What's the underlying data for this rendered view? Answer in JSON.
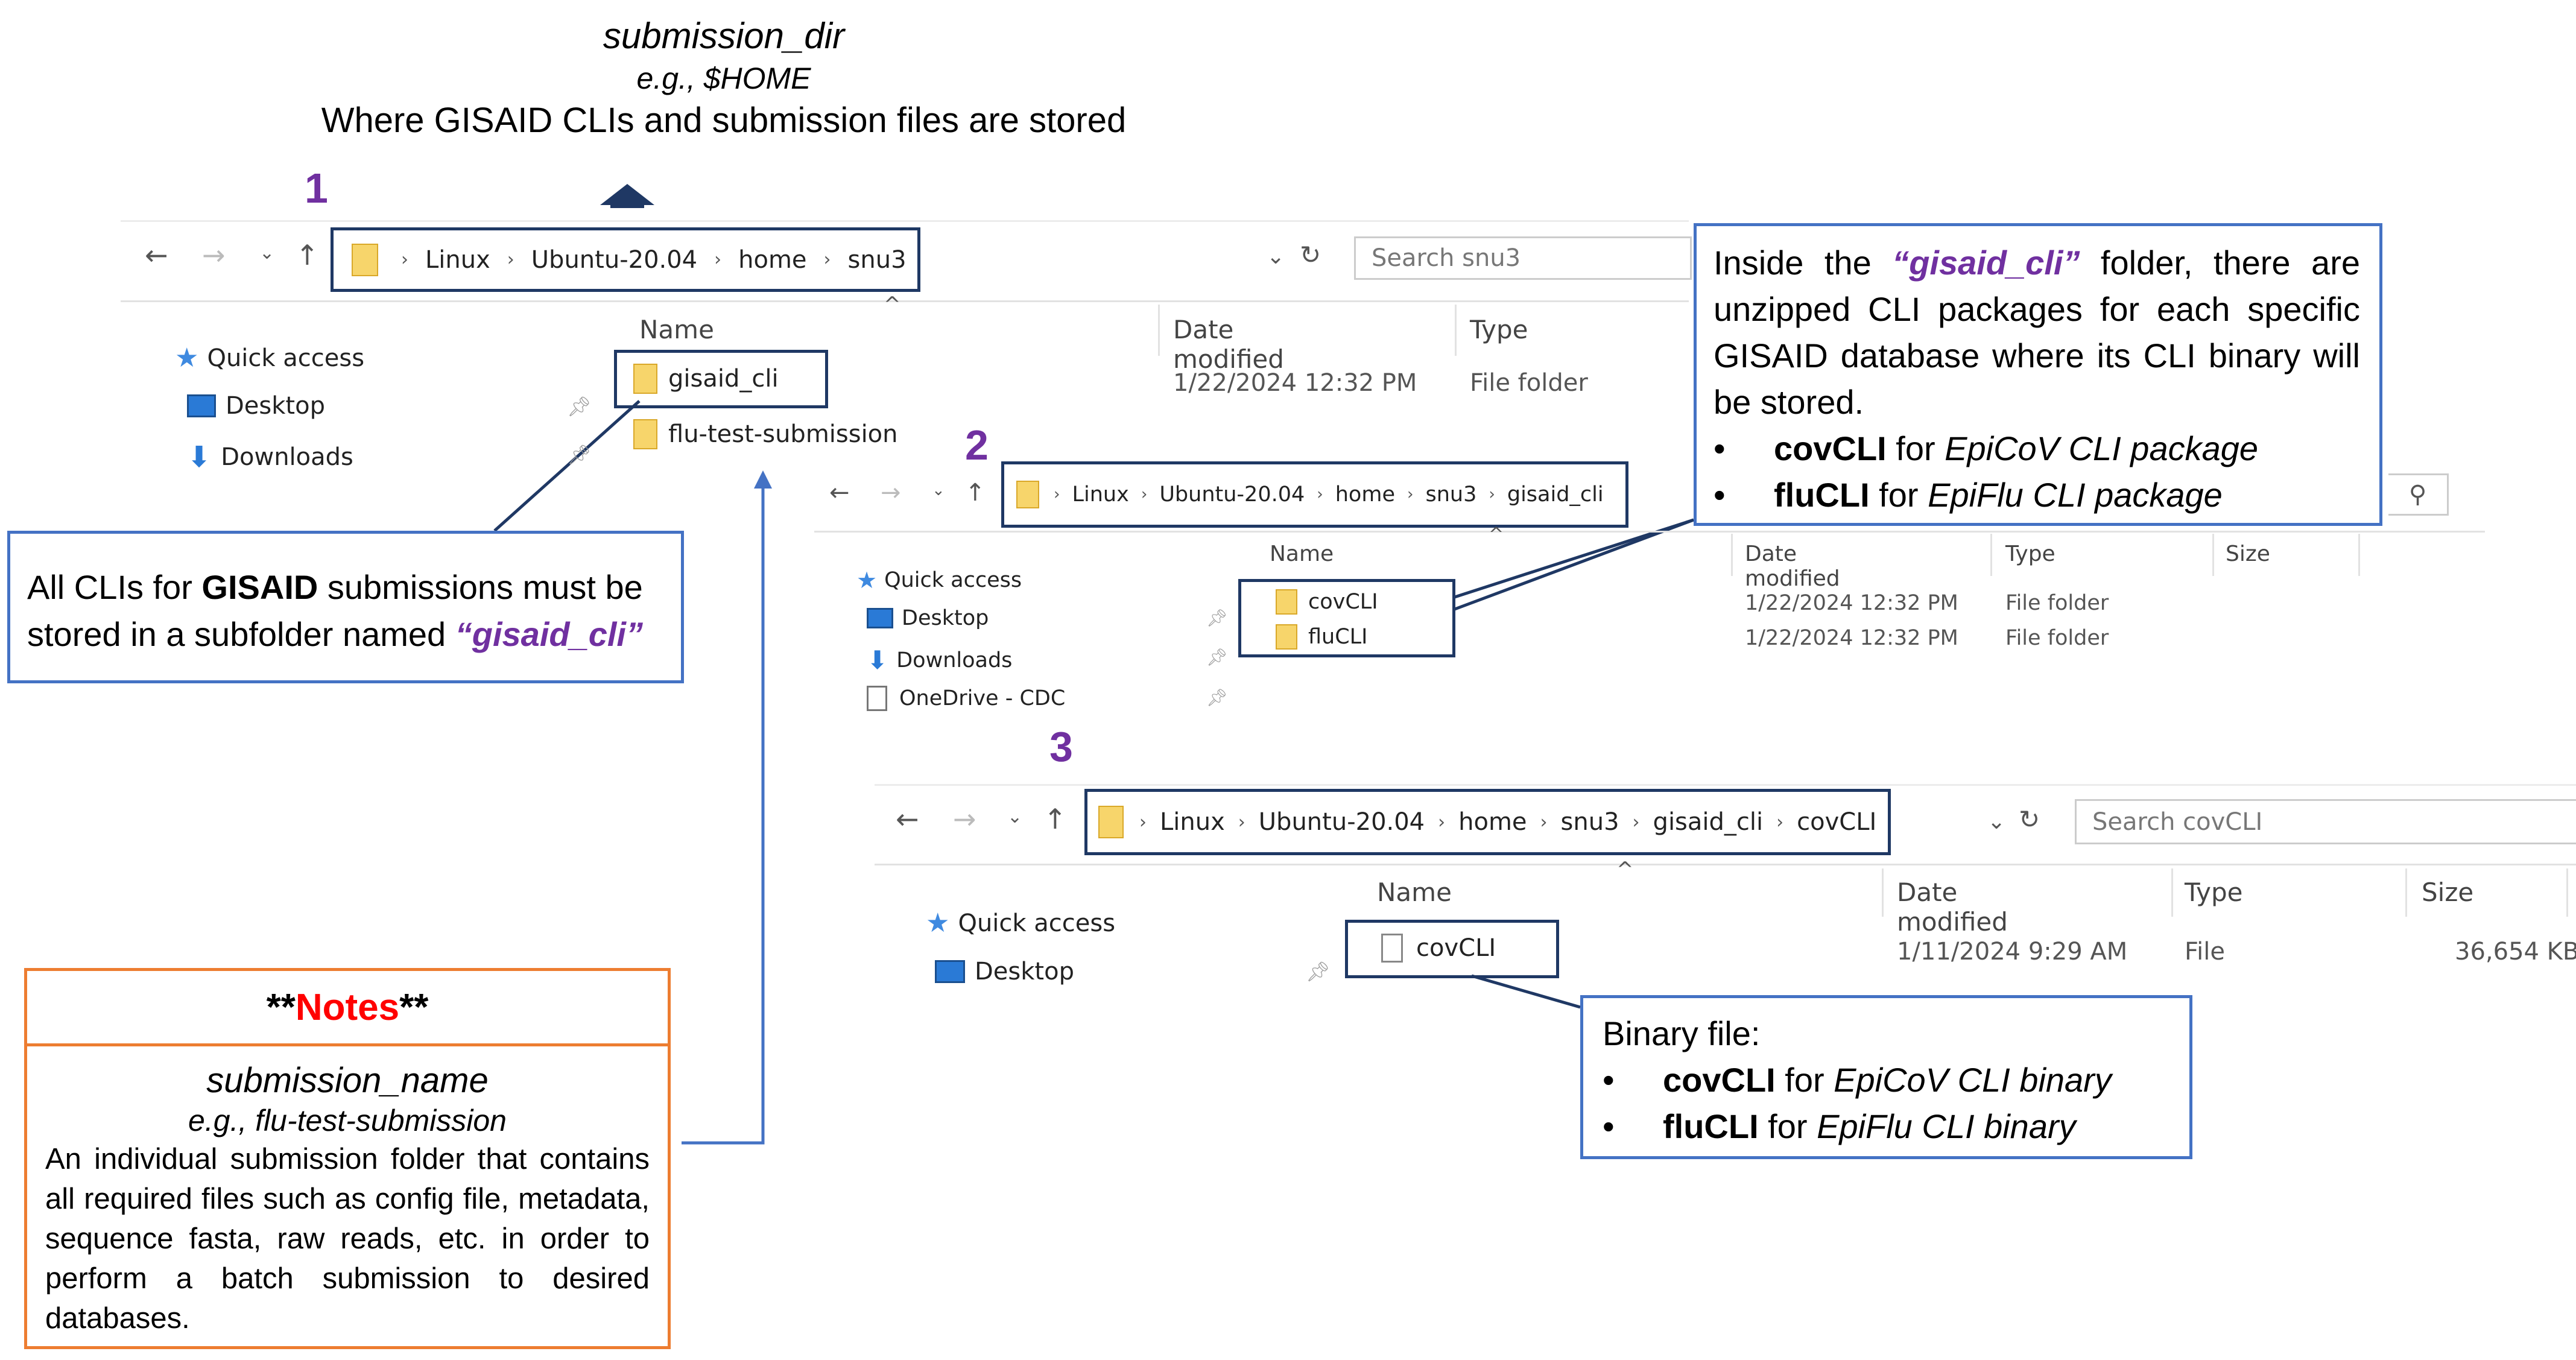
{
  "header": {
    "dir_name": "submission_dir",
    "example": "e.g., $HOME",
    "description": "Where GISAID CLIs and submission files are stored"
  },
  "steps": [
    "1",
    "2",
    "3"
  ],
  "window1": {
    "breadcrumb": [
      "Linux",
      "Ubuntu-20.04",
      "home",
      "snu3"
    ],
    "search_placeholder": "Search snu3",
    "columns": [
      "Name",
      "Date modified",
      "Type"
    ],
    "sidebar": [
      "Quick access",
      "Desktop",
      "Downloads",
      "OneDrive - CDC"
    ],
    "items": [
      {
        "name": "gisaid_cli",
        "date": "1/22/2024 12:32 PM",
        "type": "File folder"
      },
      {
        "name": "flu-test-submission"
      }
    ]
  },
  "window2": {
    "breadcrumb": [
      "Linux",
      "Ubuntu-20.04",
      "home",
      "snu3",
      "gisaid_cli"
    ],
    "columns": [
      "Name",
      "Date modified",
      "Type",
      "Size"
    ],
    "sidebar": [
      "Quick access",
      "Desktop",
      "Downloads",
      "OneDrive - CDC"
    ],
    "items": [
      {
        "name": "covCLI",
        "date": "1/22/2024 12:32 PM",
        "type": "File folder"
      },
      {
        "name": "fluCLI",
        "date": "1/22/2024 12:32 PM",
        "type": "File folder"
      }
    ]
  },
  "window3": {
    "breadcrumb": [
      "Linux",
      "Ubuntu-20.04",
      "home",
      "snu3",
      "gisaid_cli",
      "covCLI"
    ],
    "search_placeholder": "Search covCLI",
    "columns": [
      "Name",
      "Date modified",
      "Type",
      "Size"
    ],
    "sidebar": [
      "Quick access",
      "Desktop"
    ],
    "items": [
      {
        "name": "covCLI",
        "date": "1/11/2024 9:29 AM",
        "type": "File",
        "size": "36,654 KB"
      }
    ]
  },
  "callout_gisaid": {
    "line1_a": "All CLIs for ",
    "line1_b": "GISAID",
    "line1_c": " submissions must be",
    "line2_a": "stored in a subfolder named ",
    "line2_b": "“gisaid_cli”"
  },
  "callout_inside": {
    "text_a": "Inside the ",
    "text_b": "“gisaid_cli”",
    "text_c": " folder, there are unzipped CLI packages for each specific GISAID database where its CLI binary will be stored.",
    "bullets": [
      {
        "bold": "covCLI",
        "mid": " for ",
        "ital": "EpiCoV CLI package"
      },
      {
        "bold": "fluCLI",
        "mid": " for ",
        "ital": "EpiFlu CLI package"
      }
    ]
  },
  "callout_binary": {
    "title": "Binary file:",
    "bullets": [
      {
        "bold": "covCLI",
        "mid": " for ",
        "ital": "EpiCoV CLI binary"
      },
      {
        "bold": "fluCLI",
        "mid": " for ",
        "ital": "EpiFlu CLI binary"
      }
    ]
  },
  "notes": {
    "title_a": "**",
    "title_b": "Notes",
    "title_c": "**",
    "name": "submission_name",
    "example": "e.g., flu-test-submission",
    "body": "An individual submission folder that contains all required files such as config file, metadata, sequence fasta, raw reads, etc. in order to perform a batch submission to desired databases."
  },
  "colors": {
    "accent_purple": "#7030a0",
    "notes_red": "#ff0000",
    "box_blue": "#4472c4",
    "box_navy": "#1f3864",
    "notes_orange": "#ed7d31"
  }
}
